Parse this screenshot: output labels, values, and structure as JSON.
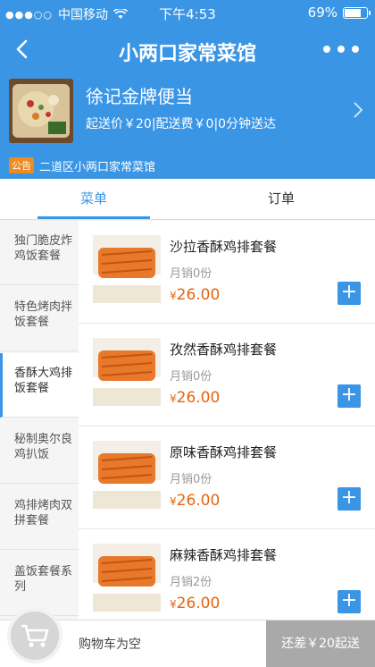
{
  "status": {
    "carrier": "中国移动",
    "time": "下午4:53",
    "battery": "69%",
    "battery_level": 0.69
  },
  "nav": {
    "title": "小两口家常菜馆"
  },
  "store": {
    "name": "徐记金牌便当",
    "info": "起送价￥20|配送费￥0|0分钟送达"
  },
  "notice": {
    "badge": "公告",
    "text": "二道区小两口家常菜馆"
  },
  "tabs": [
    {
      "label": "菜单"
    },
    {
      "label": "订单"
    }
  ],
  "categories": [
    {
      "label": "独门脆皮炸鸡饭套餐"
    },
    {
      "label": "特色烤肉拌饭套餐"
    },
    {
      "label": "香酥大鸡排饭套餐"
    },
    {
      "label": "秘制奥尔良鸡扒饭"
    },
    {
      "label": "鸡排烤肉双拼套餐"
    },
    {
      "label": "盖饭套餐系列"
    }
  ],
  "foods": [
    {
      "name": "沙拉香酥鸡排套餐",
      "sales": "月销0份",
      "currency": "¥",
      "price": "26.00"
    },
    {
      "name": "孜然香酥鸡排套餐",
      "sales": "月销0份",
      "currency": "¥",
      "price": "26.00"
    },
    {
      "name": "原味香酥鸡排套餐",
      "sales": "月销0份",
      "currency": "¥",
      "price": "26.00"
    },
    {
      "name": "麻辣香酥鸡排套餐",
      "sales": "月销2份",
      "currency": "¥",
      "price": "26.00"
    }
  ],
  "cart": {
    "empty_text": "购物车为空",
    "checkout_label": "还差￥20起送"
  },
  "colors": {
    "primary": "#3a95e5",
    "price": "#e8640c",
    "notice_badge": "#f08a1e"
  }
}
